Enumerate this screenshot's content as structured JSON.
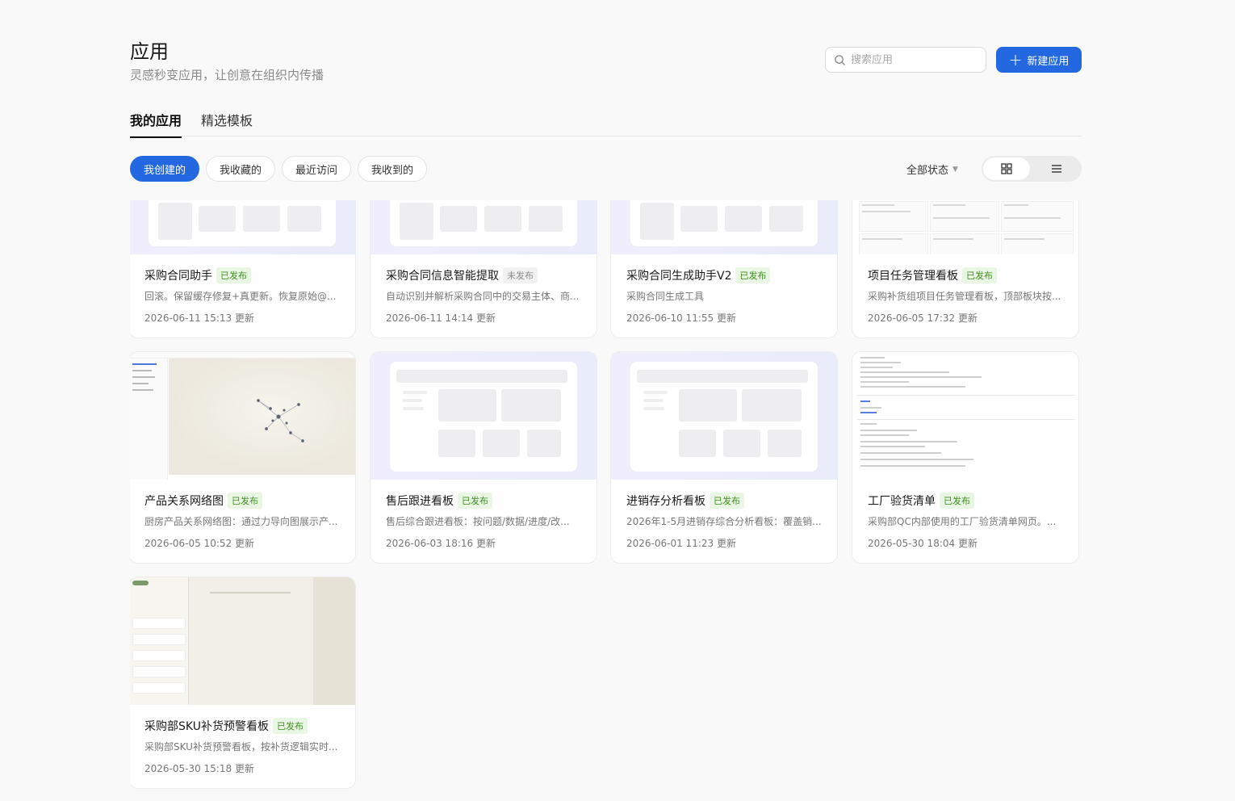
{
  "header": {
    "title": "应用",
    "subtitle": "灵感秒变应用，让创意在组织内传播"
  },
  "search": {
    "placeholder": "搜索应用"
  },
  "new_app_label": "新建应用",
  "tabs": [
    "我的应用",
    "精选模板"
  ],
  "filters": [
    "我创建的",
    "我收藏的",
    "最近访问",
    "我收到的"
  ],
  "status_filter": "全部状态",
  "apps": [
    {
      "name": "采购合同助手",
      "status": "已发布",
      "desc": "回滚。保留缓存修复+真更新。恢复原始@...",
      "time": "2026-06-11 15:13 更新"
    },
    {
      "name": "采购合同信息智能提取",
      "status": "未发布",
      "desc": "自动识别并解析采购合同中的交易主体、商...",
      "time": "2026-06-11 14:14 更新"
    },
    {
      "name": "采购合同生成助手V2",
      "status": "已发布",
      "desc": "采购合同生成工具",
      "time": "2026-06-10 11:55 更新"
    },
    {
      "name": "项目任务管理看板",
      "status": "已发布",
      "desc": "采购补货组项目任务管理看板，顶部板块按...",
      "time": "2026-06-05 17:32 更新"
    },
    {
      "name": "产品关系网络图",
      "status": "已发布",
      "desc": "厨房产品关系网络图：通过力导向图展示产...",
      "time": "2026-06-05 10:52 更新"
    },
    {
      "name": "售后跟进看板",
      "status": "已发布",
      "desc": "售后综合跟进看板：按问题/数据/进度/改...",
      "time": "2026-06-03 18:16 更新"
    },
    {
      "name": "进销存分析看板",
      "status": "已发布",
      "desc": "2026年1-5月进销存综合分析看板：覆盖销...",
      "time": "2026-06-01 11:23 更新"
    },
    {
      "name": "工厂验货清单",
      "status": "已发布",
      "desc": "采购部QC内部使用的工厂验货清单网页。...",
      "time": "2026-05-30 18:04 更新"
    },
    {
      "name": "采购部SKU补货预警看板",
      "status": "已发布",
      "desc": "采购部SKU补货预警看板，按补货逻辑实时...",
      "time": "2026-05-30 15:18 更新"
    }
  ],
  "colors": {
    "accent": "#2368e0",
    "published_bg": "#eaf6e4",
    "published_text": "#3f8f1f",
    "unpublished_bg": "#f1f1f1",
    "unpublished_text": "#8c8c8c"
  }
}
